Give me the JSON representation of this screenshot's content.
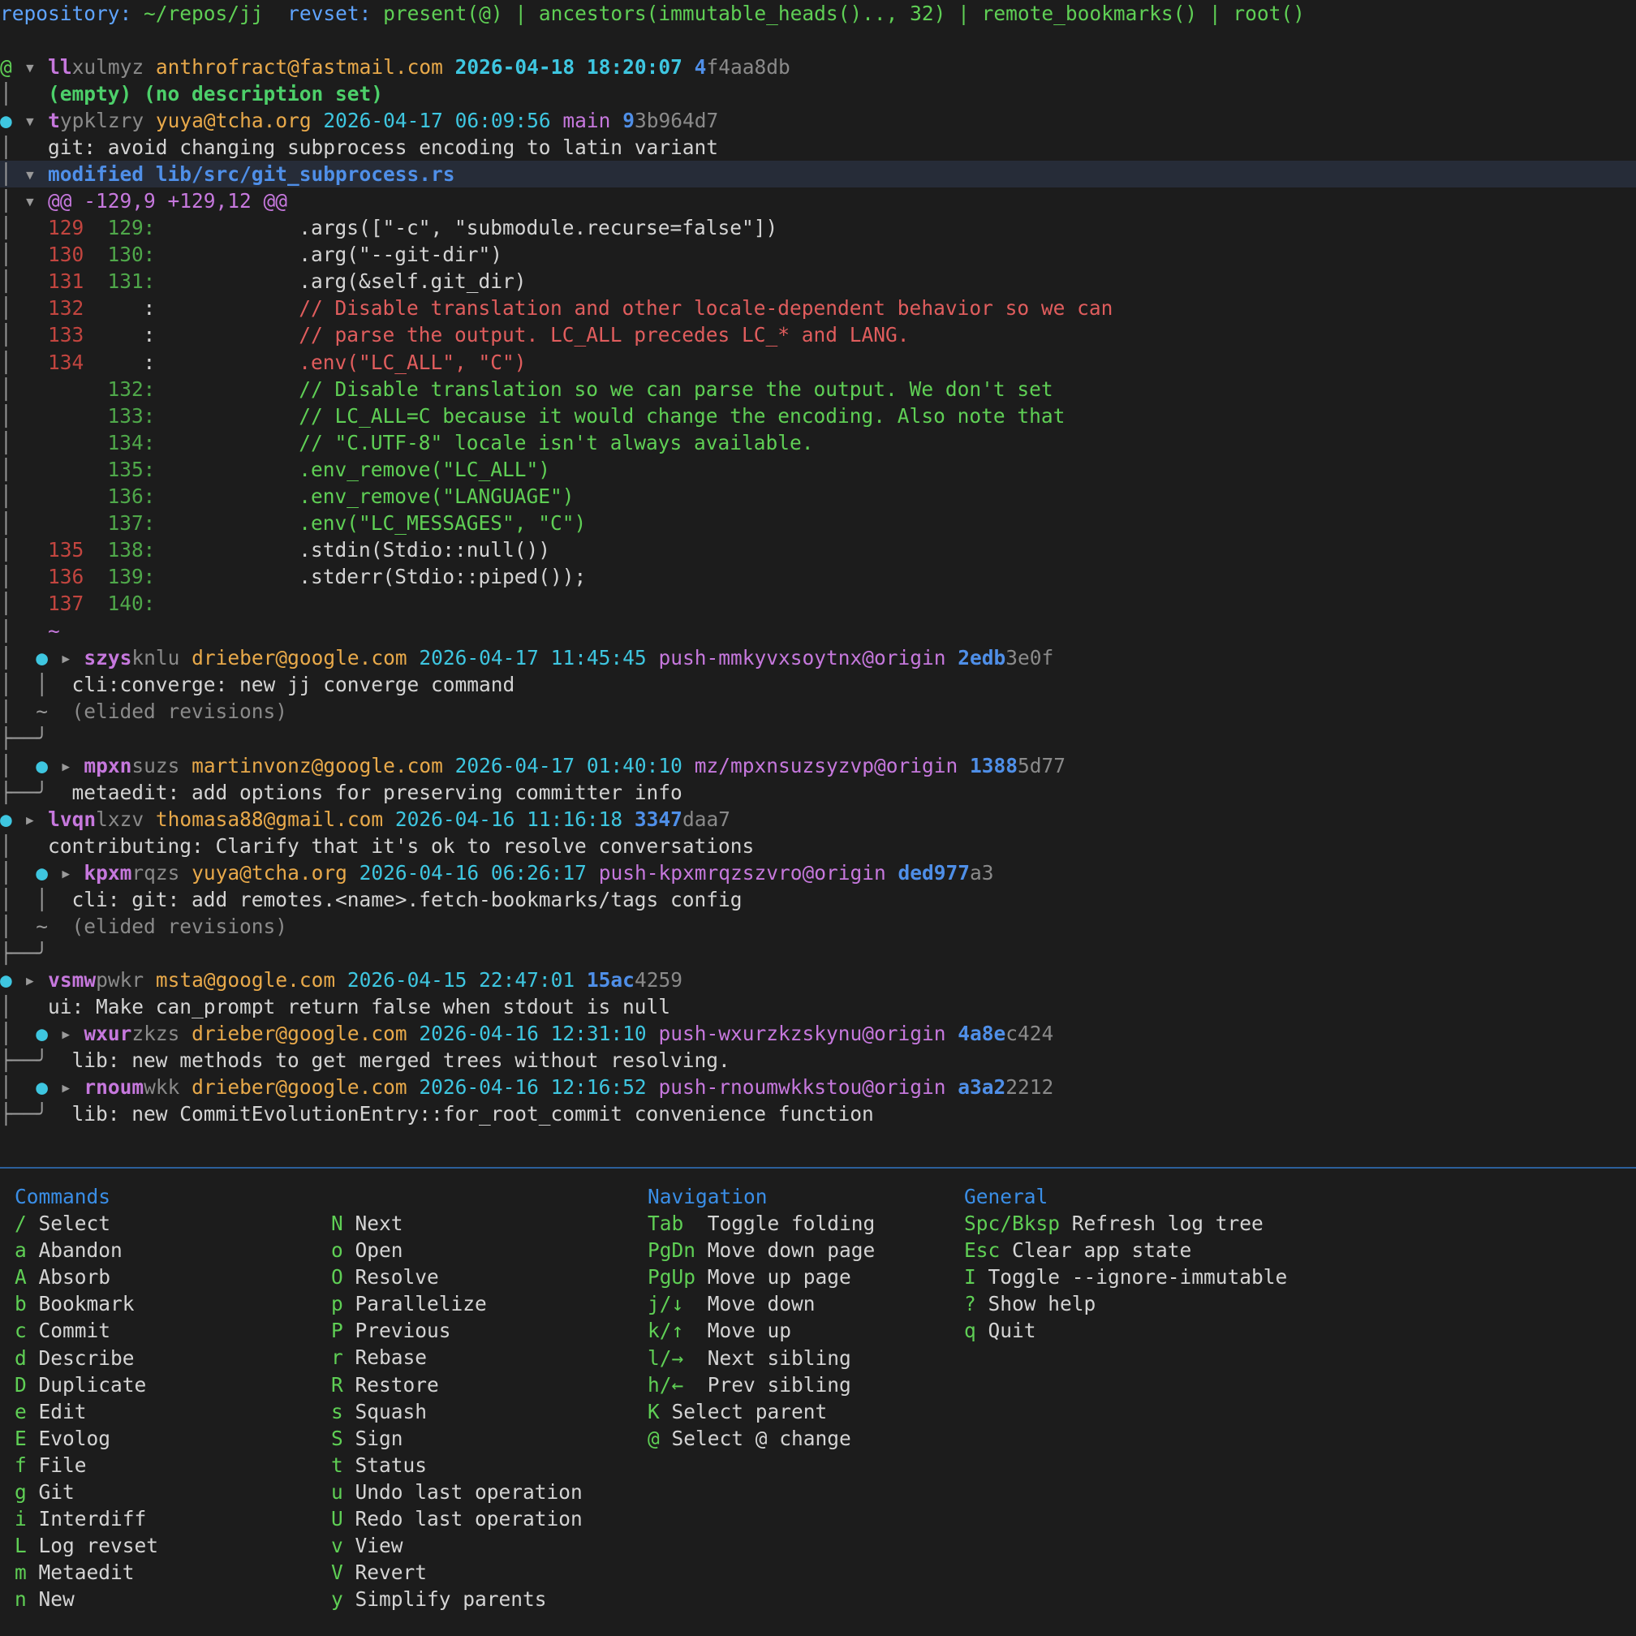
{
  "header": {
    "repository_label": "repository:",
    "repository_value": "~/repos/jj",
    "revset_label": "revset:",
    "revset_value": "present(@) | ancestors(immutable_heads().., 32) | remote_bookmarks() | root()"
  },
  "working_copy": {
    "change_id_prefix": "ll",
    "change_id_rest": "xulmyz",
    "author": "anthrofract@fastmail.com",
    "timestamp": "2026-04-18 18:20:07",
    "commit_prefix": "4",
    "commit_rest": "f4aa8db",
    "description": "(empty) (no description set)"
  },
  "expanded_commit": {
    "change_id_prefix": "t",
    "change_id_rest": "ypklzry",
    "author": "yuya@tcha.org",
    "timestamp": "2026-04-17 06:09:56",
    "bookmark": "main",
    "commit_prefix": "9",
    "commit_rest": "3b964d7",
    "description": "git: avoid changing subprocess encoding to latin variant",
    "file_header": "modified lib/src/git_subprocess.rs",
    "hunk_header": "@@ -129,9 +129,12 @@"
  },
  "diff_lines": [
    {
      "old": "129",
      "new": "129",
      "kind": "ctx",
      "text": "            .args([\"-c\", \"submodule.recurse=false\"])"
    },
    {
      "old": "130",
      "new": "130",
      "kind": "ctx",
      "text": "            .arg(\"--git-dir\")"
    },
    {
      "old": "131",
      "new": "131",
      "kind": "ctx",
      "text": "            .arg(&self.git_dir)"
    },
    {
      "old": "132",
      "new": "",
      "kind": "del",
      "text": "            // Disable translation and other locale-dependent behavior so we can"
    },
    {
      "old": "133",
      "new": "",
      "kind": "del",
      "text": "            // parse the output. LC_ALL precedes LC_* and LANG."
    },
    {
      "old": "134",
      "new": "",
      "kind": "del",
      "text": "            .env(\"LC_ALL\", \"C\")"
    },
    {
      "old": "",
      "new": "132",
      "kind": "add",
      "text": "            // Disable translation so we can parse the output. We don't set"
    },
    {
      "old": "",
      "new": "133",
      "kind": "add",
      "text": "            // LC_ALL=C because it would change the encoding. Also note that"
    },
    {
      "old": "",
      "new": "134",
      "kind": "add",
      "text": "            // \"C.UTF-8\" locale isn't always available."
    },
    {
      "old": "",
      "new": "135",
      "kind": "add",
      "text": "            .env_remove(\"LC_ALL\")"
    },
    {
      "old": "",
      "new": "136",
      "kind": "add",
      "text": "            .env_remove(\"LANGUAGE\")"
    },
    {
      "old": "",
      "new": "137",
      "kind": "add",
      "text": "            .env(\"LC_MESSAGES\", \"C\")"
    },
    {
      "old": "135",
      "new": "138",
      "kind": "ctx",
      "text": "            .stdin(Stdio::null())"
    },
    {
      "old": "136",
      "new": "139",
      "kind": "ctx",
      "text": "            .stderr(Stdio::piped());"
    },
    {
      "old": "137",
      "new": "140",
      "kind": "ctx",
      "text": ""
    }
  ],
  "diff_end_marker": "~",
  "commits": [
    {
      "id": "szys",
      "rest": "knlu",
      "author": "drieber@google.com",
      "timestamp": "2026-04-17 11:45:45",
      "bookmark": "push-mmkyvxsoytnx@origin",
      "hash_prefix": "2edb",
      "hash_rest": "3e0f",
      "description": "cli:converge: new jj converge command"
    },
    {
      "id": "mpxn",
      "rest": "suzs",
      "author": "martinvonz@google.com",
      "timestamp": "2026-04-17 01:40:10",
      "bookmark": "mz/mpxnsuzsyzvp@origin",
      "hash_prefix": "1388",
      "hash_rest": "5d77",
      "description": "metaedit: add options for preserving committer info"
    },
    {
      "id": "lvqn",
      "rest": "lxzv",
      "author": "thomasa88@gmail.com",
      "timestamp": "2026-04-16 11:16:18",
      "bookmark": "",
      "hash_prefix": "3347",
      "hash_rest": "daa7",
      "description": "contributing: Clarify that it's ok to resolve conversations"
    },
    {
      "id": "kpxm",
      "rest": "rqzs",
      "author": "yuya@tcha.org",
      "timestamp": "2026-04-16 06:26:17",
      "bookmark": "push-kpxmrqzszvro@origin",
      "hash_prefix": "ded977",
      "hash_rest": "a3",
      "description": "cli: git: add remotes.<name>.fetch-bookmarks/tags config"
    },
    {
      "id": "vsmw",
      "rest": "pwkr",
      "author": "msta@google.com",
      "timestamp": "2026-04-15 22:47:01",
      "bookmark": "",
      "hash_prefix": "15ac",
      "hash_rest": "4259",
      "description": "ui: Make can_prompt return false when stdout is null"
    },
    {
      "id": "wxur",
      "rest": "zkzs",
      "author": "drieber@google.com",
      "timestamp": "2026-04-16 12:31:10",
      "bookmark": "push-wxurzkzskynu@origin",
      "hash_prefix": "4a8e",
      "hash_rest": "c424",
      "description": "lib: new methods to get merged trees without resolving."
    },
    {
      "id": "rnoum",
      "rest": "wkk",
      "author": "drieber@google.com",
      "timestamp": "2026-04-16 12:16:52",
      "bookmark": "push-rnoumwkkstou@origin",
      "hash_prefix": "a3a2",
      "hash_rest": "2212",
      "description": "lib: new CommitEvolutionEntry::for_root_commit convenience function"
    }
  ],
  "elided_label": "(elided revisions)",
  "help": {
    "commands_title": "Commands",
    "commands_a": [
      {
        "key": "/",
        "label": "Select"
      },
      {
        "key": "a",
        "label": "Abandon"
      },
      {
        "key": "A",
        "label": "Absorb"
      },
      {
        "key": "b",
        "label": "Bookmark"
      },
      {
        "key": "c",
        "label": "Commit"
      },
      {
        "key": "d",
        "label": "Describe"
      },
      {
        "key": "D",
        "label": "Duplicate"
      },
      {
        "key": "e",
        "label": "Edit"
      },
      {
        "key": "E",
        "label": "Evolog"
      },
      {
        "key": "f",
        "label": "File"
      },
      {
        "key": "g",
        "label": "Git"
      },
      {
        "key": "i",
        "label": "Interdiff"
      },
      {
        "key": "L",
        "label": "Log revset"
      },
      {
        "key": "m",
        "label": "Metaedit"
      },
      {
        "key": "n",
        "label": "New"
      }
    ],
    "commands_b": [
      {
        "key": "N",
        "label": "Next"
      },
      {
        "key": "o",
        "label": "Open"
      },
      {
        "key": "O",
        "label": "Resolve"
      },
      {
        "key": "p",
        "label": "Parallelize"
      },
      {
        "key": "P",
        "label": "Previous"
      },
      {
        "key": "r",
        "label": "Rebase"
      },
      {
        "key": "R",
        "label": "Restore"
      },
      {
        "key": "s",
        "label": "Squash"
      },
      {
        "key": "S",
        "label": "Sign"
      },
      {
        "key": "t",
        "label": "Status"
      },
      {
        "key": "u",
        "label": "Undo last operation"
      },
      {
        "key": "U",
        "label": "Redo last operation"
      },
      {
        "key": "v",
        "label": "View"
      },
      {
        "key": "V",
        "label": "Revert"
      },
      {
        "key": "y",
        "label": "Simplify parents"
      }
    ],
    "navigation_title": "Navigation",
    "navigation": [
      {
        "key": "Tab ",
        "label": "Toggle folding"
      },
      {
        "key": "PgDn",
        "label": "Move down page"
      },
      {
        "key": "PgUp",
        "label": "Move up page"
      },
      {
        "key": "j/↓ ",
        "label": "Move down"
      },
      {
        "key": "k/↑ ",
        "label": "Move up"
      },
      {
        "key": "l/→ ",
        "label": "Next sibling"
      },
      {
        "key": "h/← ",
        "label": "Prev sibling"
      },
      {
        "key": "K",
        "label": "Select parent"
      },
      {
        "key": "@",
        "label": "Select @ change"
      }
    ],
    "general_title": "General",
    "general": [
      {
        "key": "Spc/Bksp",
        "label": "Refresh log tree"
      },
      {
        "key": "Esc",
        "label": "Clear app state"
      },
      {
        "key": "I",
        "label": "Toggle --ignore-immutable"
      },
      {
        "key": "?",
        "label": "Show help"
      },
      {
        "key": "q",
        "label": "Quit"
      }
    ]
  }
}
